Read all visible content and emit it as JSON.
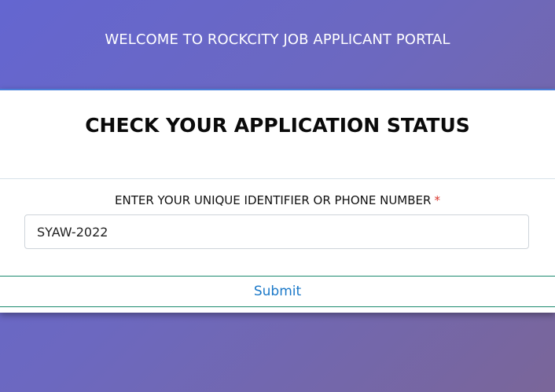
{
  "header": {
    "title": "WELCOME TO ROCKCITY JOB APPLICANT PORTAL"
  },
  "card": {
    "title": "CHECK YOUR APPLICATION STATUS",
    "field_label": "ENTER YOUR UNIQUE IDENTIFIER OR PHONE NUMBER",
    "required_marker": "*",
    "field_value": "SYAW-2022",
    "submit_label": "Submit"
  },
  "colors": {
    "header_gradient_start": "#6466d0",
    "header_gradient_end": "#7a6699",
    "card_top_border": "#4a7fd8",
    "submit_border": "#1a8a6e",
    "submit_text": "#1a78c8",
    "required_marker": "#d9342b"
  }
}
